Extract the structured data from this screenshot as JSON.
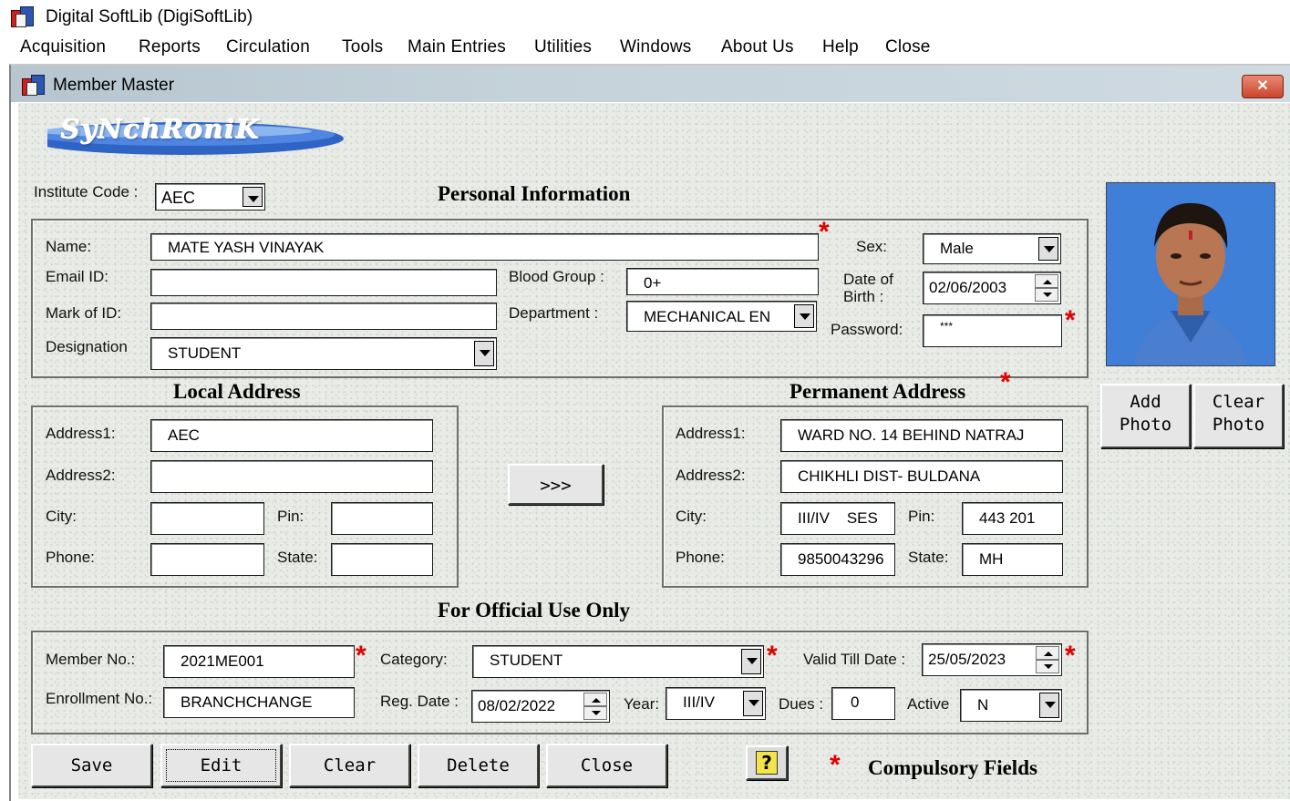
{
  "app": {
    "title": "Digital SoftLib (DigiSoftLib)"
  },
  "menu": [
    "Acquisition",
    "Reports",
    "Circulation",
    "Tools",
    "Main Entries",
    "Utilities",
    "Windows",
    "About Us",
    "Help",
    "Close"
  ],
  "window": {
    "title": "Member Master",
    "close_glyph": "✕"
  },
  "logo": {
    "text": "SyNchRoniK"
  },
  "institute": {
    "label": "Institute Code :",
    "value": "AEC"
  },
  "personal": {
    "heading": "Personal Information",
    "name_label": "Name:",
    "name_value": "MATE YASH VINAYAK",
    "email_label": "Email ID:",
    "email_value": "",
    "mark_label": "Mark of ID:",
    "mark_value": "",
    "designation_label": "Designation",
    "designation_value": "STUDENT",
    "blood_label": "Blood Group :",
    "blood_value": "0+",
    "dept_label": "Department :",
    "dept_value": "MECHANICAL EN",
    "sex_label": "Sex:",
    "sex_value": "Male",
    "dob_label_1": "Date of",
    "dob_label_2": "Birth :",
    "dob_value": "02/06/2003",
    "password_label": "Password:",
    "password_value": "***"
  },
  "local": {
    "heading": "Local Address",
    "address1_label": "Address1:",
    "address1_value": "AEC",
    "address2_label": "Address2:",
    "address2_value": "",
    "city_label": "City:",
    "city_value": "",
    "pin_label": "Pin:",
    "pin_value": "",
    "phone_label": "Phone:",
    "phone_value": "",
    "state_label": "State:",
    "state_value": ""
  },
  "copy_button": ">>>",
  "permanent": {
    "heading": "Permanent Address",
    "address1_label": "Address1:",
    "address1_value": "WARD NO. 14 BEHIND NATRAJ",
    "address2_label": "Address2:",
    "address2_value": "CHIKHLI DIST- BULDANA",
    "city_label": "City:",
    "city_value": "III/IV    SES",
    "pin_label": "Pin:",
    "pin_value": "443 201",
    "phone_label": "Phone:",
    "phone_value": "9850043296",
    "state_label": "State:",
    "state_value": "MH"
  },
  "photo_buttons": {
    "add_1": "Add",
    "add_2": "Photo",
    "clear_1": "Clear",
    "clear_2": "Photo"
  },
  "official": {
    "heading": "For Official Use Only",
    "member_label": "Member No.:",
    "member_value": "2021ME001",
    "category_label": "Category:",
    "category_value": "STUDENT",
    "valid_label": "Valid Till Date :",
    "valid_value": "25/05/2023",
    "enroll_label": "Enrollment No.:",
    "enroll_value": "BRANCHCHANGE",
    "reg_label": "Reg. Date :",
    "reg_value": "08/02/2022",
    "year_label": "Year:",
    "year_value": "III/IV",
    "dues_label": "Dues :",
    "dues_value": "0",
    "active_label": "Active",
    "active_value": "N"
  },
  "actions": {
    "save": "Save",
    "edit": "Edit",
    "clear": "Clear",
    "delete": "Delete",
    "close": "Close"
  },
  "help_glyph": "?",
  "required_star": "*",
  "compulsory": "Compulsory Fields"
}
